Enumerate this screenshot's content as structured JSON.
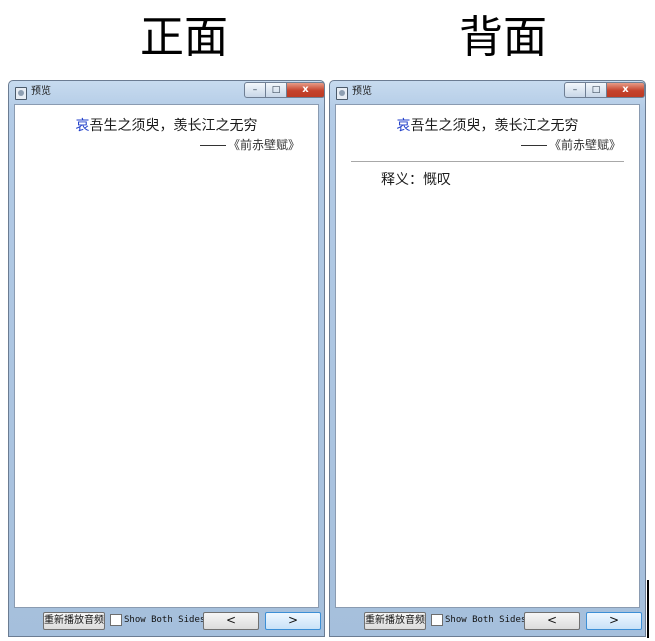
{
  "headings": {
    "front": "正面",
    "back": "背面"
  },
  "windows": [
    {
      "title": "预览",
      "card": {
        "highlight": "哀",
        "text": "吾生之须臾，羡长江之无穷",
        "source": "《前赤壁赋》"
      },
      "footer": {
        "replay_label": "重新播放音频",
        "show_both_label": "Show Both Sides",
        "prev_label": "<",
        "next_label": ">"
      }
    },
    {
      "title": "预览",
      "card": {
        "highlight": "哀",
        "text": "吾生之须臾，羡长江之无穷",
        "source": "《前赤壁赋》",
        "answer": "释义：慨叹"
      },
      "footer": {
        "replay_label": "重新播放音频",
        "show_both_label": "Show Both Sides",
        "prev_label": "<",
        "next_label": ">"
      }
    }
  ],
  "titlebar_glyphs": {
    "minimize": "–",
    "maximize": "□",
    "close": "x"
  },
  "colors": {
    "highlight": "#1f3ec9",
    "close_button": "#c5422c",
    "window_frame": "#b3cbe6"
  }
}
